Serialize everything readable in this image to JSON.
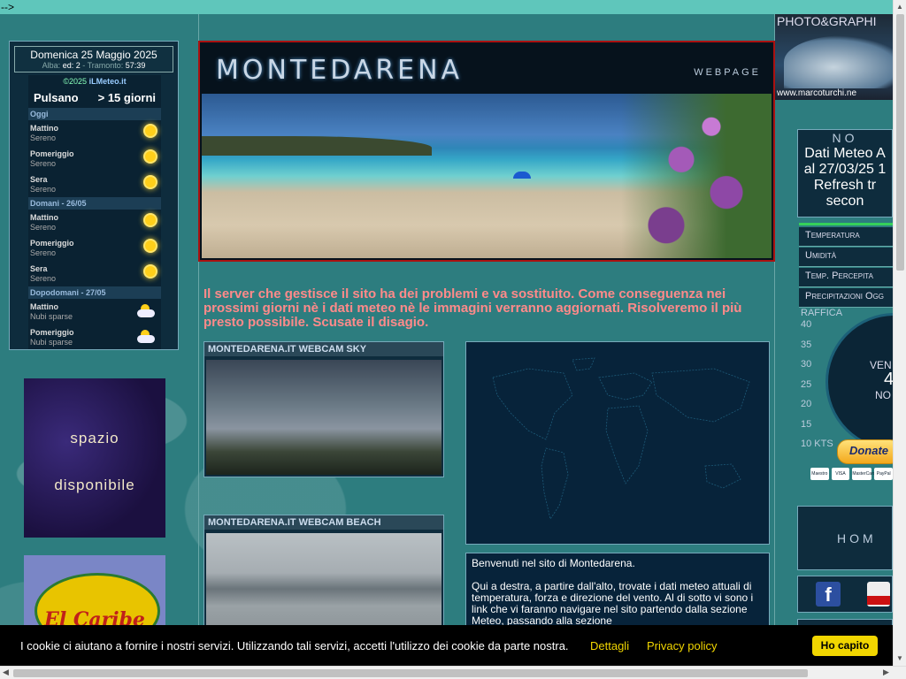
{
  "topbar": {
    "text": "-->"
  },
  "weather": {
    "date": "Domenica 25 Maggio 2025",
    "alba_label": "Alba:",
    "alba_value": "ed: 2",
    "sep": "-",
    "tramonto_label": "Tramonto:",
    "tramonto_value": "57:39",
    "copyright": "©2025",
    "brand": "iLMeteo.it",
    "city": "Pulsano",
    "range": "> 15 giorni",
    "sections": [
      {
        "title": "Oggi",
        "rows": [
          {
            "time": "Mattino",
            "desc": "Sereno",
            "icon": "sun-icon"
          },
          {
            "time": "Pomeriggio",
            "desc": "Sereno",
            "icon": "sun-icon"
          },
          {
            "time": "Sera",
            "desc": "Sereno",
            "icon": "sun-icon"
          }
        ]
      },
      {
        "title": "Domani - 26/05",
        "rows": [
          {
            "time": "Mattino",
            "desc": "Sereno",
            "icon": "sun-icon"
          },
          {
            "time": "Pomeriggio",
            "desc": "Sereno",
            "icon": "sun-icon"
          },
          {
            "time": "Sera",
            "desc": "Sereno",
            "icon": "sun-icon"
          }
        ]
      },
      {
        "title": "Dopodomani - 27/05",
        "rows": [
          {
            "time": "Mattino",
            "desc": "Nubi sparse",
            "icon": "cloud-sun-icon"
          },
          {
            "time": "Pomeriggio",
            "desc": "Nubi sparse",
            "icon": "cloud-sun-icon"
          }
        ]
      }
    ]
  },
  "ads": {
    "ad1_line1": "spazio",
    "ad1_line2": "disponibile",
    "ad2_text": "El Caribe"
  },
  "banner": {
    "title": "MONTEDARENA",
    "subtitle": "WEBPAGE"
  },
  "notice": "Il server che gestisce il sito ha dei problemi e va sostituito. Come conseguenza nei prossimi giorni nè i dati meteo nè le immagini verranno aggiornati. Risolveremo il più presto possibile. Scusate il disagio.",
  "webcams": {
    "sky_title": "MONTEDARENA.IT WEBCAM SKY",
    "beach_title": "MONTEDARENA.IT WEBCAM BEACH"
  },
  "welcome": {
    "line1": "Benvenuti nel sito di Montedarena.",
    "line2": "Qui a destra, a partire dall'alto, trovate i dati meteo attuali di temperatura, forza e direzione del vento. Al di sotto vi sono i link che vi faranno navigare nel sito partendo dalla sezione Meteo, passando alla sezione"
  },
  "right": {
    "photo_title": "PHOTO&GRAPHI",
    "photo_url": "www.marcoturchi.ne",
    "notice_head": "NO",
    "notice_lines": [
      "Dati Meteo A",
      "al 27/03/25 1",
      "Refresh tr",
      "secon"
    ],
    "menu": [
      "Temperatura",
      "Umidità",
      "Temp. Percepita",
      "Precipitazioni Ogg"
    ],
    "gauge_label": "RAFFICA",
    "gauge_scale": [
      "40",
      "35",
      "30",
      "25",
      "20",
      "15",
      "10 KTS"
    ],
    "gauge_ven": "VEN",
    "gauge_num": "4",
    "gauge_no": "NO",
    "donate": "Donate",
    "cards": [
      "Maestro",
      "VISA",
      "MasterCard",
      "PayPal"
    ],
    "home": "HOM"
  },
  "cookie": {
    "message": "I cookie ci aiutano a fornire i nostri servizi. Utilizzando tali servizi, accetti l'utilizzo dei cookie da parte nostra.",
    "details": "Dettagli",
    "privacy": "Privacy policy",
    "accept": "Ho capito"
  },
  "colors": {
    "background": "#2e7f80",
    "notice": "#ff8a8a",
    "accent_yellow": "#f1d600",
    "banner_border": "#aa1111"
  }
}
